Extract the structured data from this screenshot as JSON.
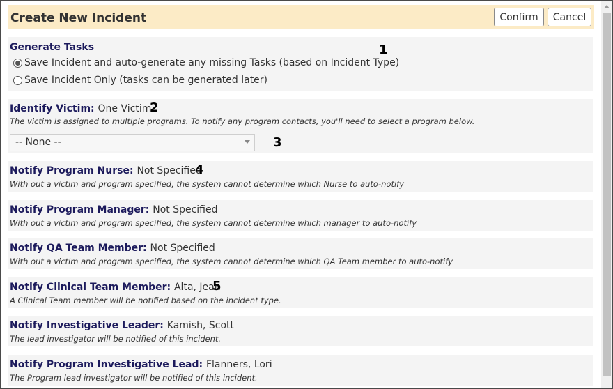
{
  "dialog": {
    "title": "Create New Incident",
    "confirm_label": "Confirm",
    "cancel_label": "Cancel"
  },
  "sections": {
    "generate_tasks": {
      "title": "Generate Tasks",
      "number": "1",
      "options": [
        {
          "label": "Save Incident and auto-generate any missing Tasks (based on Incident Type)",
          "selected": true
        },
        {
          "label": "Save Incident Only (tasks can be generated later)",
          "selected": false
        }
      ]
    },
    "victim": {
      "title": "Identify Victim:",
      "value": "One Victim",
      "number": "2",
      "desc": "The victim is assigned to multiple programs. To notify any program contacts, you'll need to select a program below.",
      "program_select": "-- None --",
      "select_number": "3"
    },
    "nurse": {
      "title": "Notify Program Nurse:",
      "value": "Not Specified",
      "number": "4",
      "desc": "With out a victim and program specified, the system cannot determine which Nurse to auto-notify"
    },
    "manager": {
      "title": "Notify Program Manager:",
      "value": "Not Specified",
      "desc": "With out a victim and program specified, the system cannot determine which manager to auto-notify"
    },
    "qa": {
      "title": "Notify QA Team Member:",
      "value": "Not Specified",
      "desc": "With out a victim and program specified, the system cannot determine which QA Team member to auto-notify"
    },
    "clinical": {
      "title": "Notify Clinical Team Member:",
      "value": "Alta, Jean",
      "number": "5",
      "desc": "A Clinical Team member will be notified based on the incident type."
    },
    "investigative": {
      "title": "Notify Investigative Leader:",
      "value": "Kamish, Scott",
      "desc": "The lead investigator will be notified of this incident."
    },
    "program_investigative": {
      "title": "Notify Program Investigative Lead:",
      "value": "Flanners, Lori",
      "desc": "The Program lead investigator will be notified of this incident."
    }
  }
}
